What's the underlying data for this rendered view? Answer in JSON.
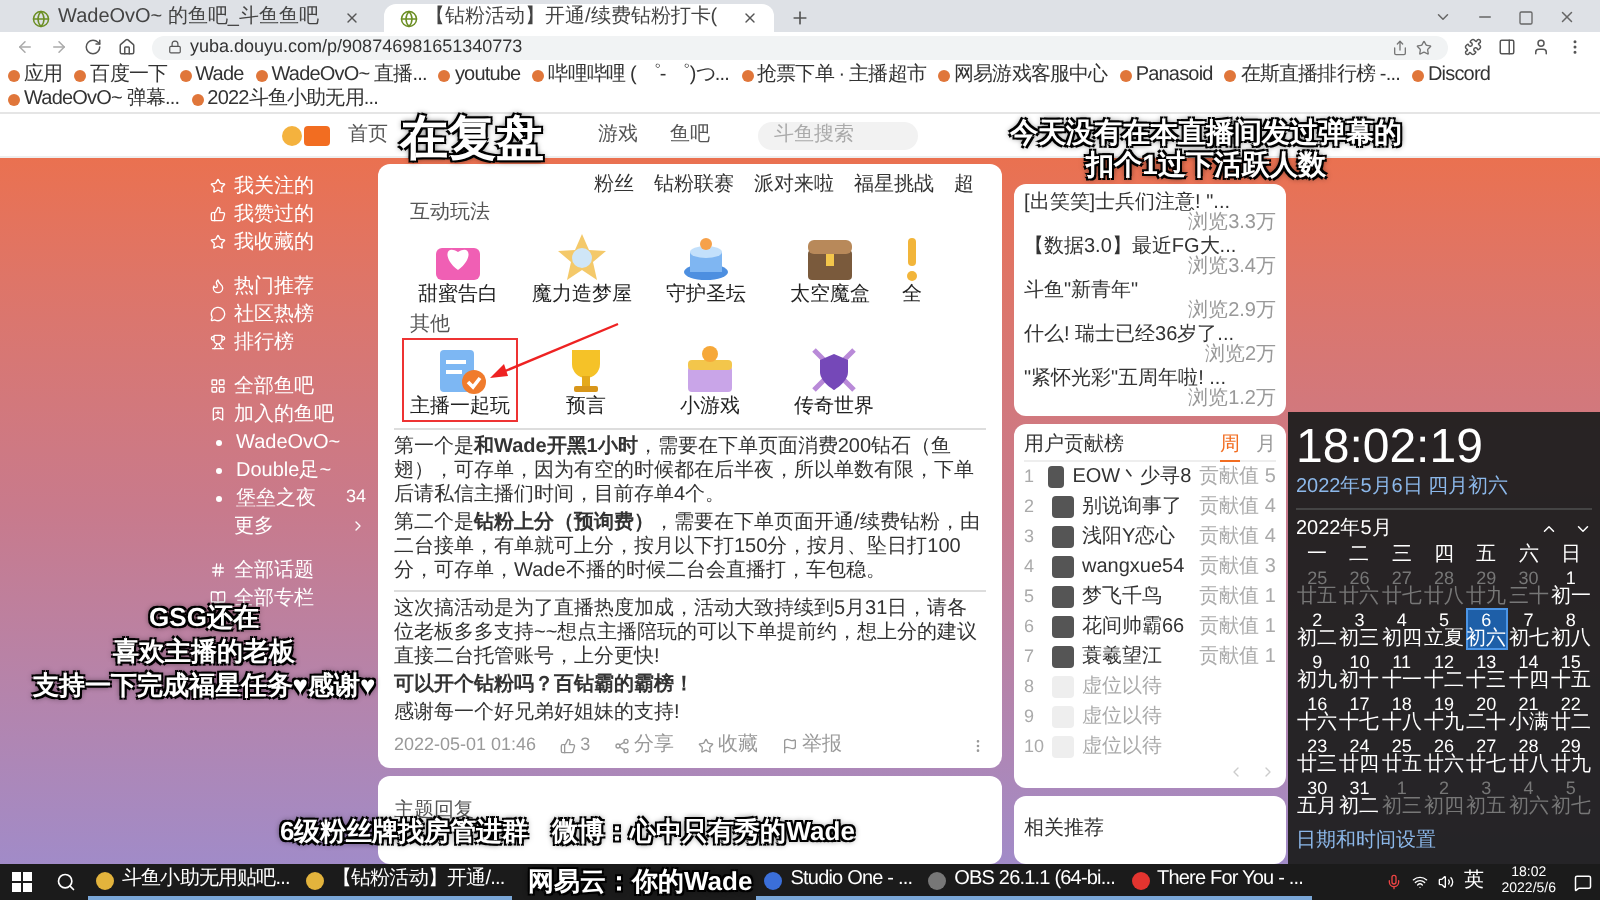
{
  "browser": {
    "tabs": [
      {
        "label": "WadeOvO~ 的鱼吧_斗鱼鱼吧",
        "selected": false
      },
      {
        "label": "【钻粉活动】开通/续费钻粉打卡(",
        "selected": true
      }
    ],
    "address": "yuba.douyu.com/p/908746981651340773",
    "bookmarks": [
      "应用",
      "百度一下",
      "Wade",
      "WadeOvO~ 直播...",
      "youtube",
      "哔哩哔哩 ( ゜- ゜)つ...",
      "抢票下单 · 主播超市",
      "网易游戏客服中心",
      "Panasoid",
      "在斯直播排行榜 -...",
      "Discord",
      "WadeOvO~ 弹幕...",
      "2022斗鱼小助无用..."
    ]
  },
  "site_header": {
    "nav": [
      "首页",
      "游戏",
      "鱼吧"
    ],
    "search": {
      "placeholder": "斗鱼搜索"
    }
  },
  "sidebar": {
    "groups": [
      {
        "items": [
          {
            "label": "我关注的",
            "kind": "link"
          },
          {
            "label": "我赞过的",
            "kind": "link"
          },
          {
            "label": "我收藏的",
            "kind": "link"
          }
        ]
      },
      {
        "items": [
          {
            "label": "热门推荐",
            "kind": "link"
          },
          {
            "label": "社区热榜",
            "kind": "link"
          },
          {
            "label": "排行榜",
            "kind": "link"
          }
        ]
      },
      {
        "items": [
          {
            "label": "全部鱼吧",
            "kind": "link"
          },
          {
            "label": "加入的鱼吧",
            "kind": "link"
          },
          {
            "label": "WadeOvO~",
            "kind": "bar"
          },
          {
            "label": "Double足~",
            "kind": "bar"
          },
          {
            "label": "堡垒之夜",
            "kind": "bar",
            "count": "34"
          },
          {
            "label": "更多",
            "kind": "more"
          }
        ]
      },
      {
        "items": [
          {
            "label": "全部话题",
            "kind": "link"
          },
          {
            "label": "全部专栏",
            "kind": "link"
          }
        ]
      }
    ]
  },
  "post": {
    "tabs": [
      "粉丝",
      "钻粉联赛",
      "派对来啦",
      "福星挑战",
      "超"
    ],
    "sections": [
      {
        "title": "互动玩法",
        "items": [
          {
            "label": "甜蜜告白",
            "highlighted": false
          },
          {
            "label": "魔力造梦屋",
            "highlighted": false
          },
          {
            "label": "守护圣坛",
            "highlighted": false
          },
          {
            "label": "太空魔盒",
            "highlighted": false
          },
          {
            "label": "全",
            "highlighted": false
          }
        ]
      },
      {
        "title": "其他",
        "items": [
          {
            "label": "主播一起玩",
            "highlighted": true
          },
          {
            "label": "预言",
            "highlighted": false
          },
          {
            "label": "小游戏",
            "highlighted": false
          },
          {
            "label": "传奇世界",
            "highlighted": false
          }
        ]
      }
    ],
    "blocks": [
      {
        "paragraphs": [
          {
            "kind": "body",
            "text": "第一个是**和Wade开黑1小时**，需要在下单页面消费200钻石（鱼翅），可存单，因为有空的时候都在后半夜，所以单数有限，下单后请私信主播们时间，目前存单4个。"
          },
          {
            "kind": "body",
            "text": "第二个是**钻粉上分（预询费）**，需要在下单页面开通/续费钻粉，由二台接单，有单就可上分，按月以下打150分，按月、坠日打100分，可存单，Wade不播的时候二台会直播打，车包稳。"
          }
        ]
      },
      {
        "paragraphs": [
          {
            "kind": "body",
            "text": "这次搞活动是为了直播热度加成，活动大致持续到5月31日，请各位老板多多支持~~想点主播陪玩的可以下单提前约，想上分的建议直接二台托管账号，上分更快!"
          },
          {
            "kind": "bold",
            "text": "可以开个钻粉吗？百钻霸的霸榜！"
          },
          {
            "kind": "body",
            "text": "感谢每一个好兄弟好姐妹的支持!"
          }
        ]
      }
    ],
    "meta": {
      "date": "2022-05-01 01:46",
      "likes": "3",
      "actions": [
        "分享",
        "收藏",
        "举报"
      ]
    }
  },
  "replies": {
    "title": "主题回复"
  },
  "hot_posts": [
    {
      "title": "[出笑笑]士兵们注意! \"...",
      "views": "浏览3.3万"
    },
    {
      "title": "【数据3.0】最近FG大...",
      "views": "浏览3.4万"
    },
    {
      "title": "斗鱼\"新青年\"",
      "views": "浏览2.9万"
    },
    {
      "title": "什么! 瑞士已经36岁了...",
      "views": "浏览2万"
    },
    {
      "title": "\"紧怀光彩\"五周年啦! ...",
      "views": "浏览1.2万"
    }
  ],
  "ranking": {
    "title": "用户贡献榜",
    "tabs": [
      {
        "label": "周",
        "selected": true
      },
      {
        "label": "月",
        "selected": false
      }
    ],
    "rows": [
      {
        "kind": "user",
        "rank": "1",
        "name": "EOW丶少寻8",
        "score": "贡献值 5"
      },
      {
        "kind": "user",
        "rank": "2",
        "name": "别说询事了",
        "score": "贡献值 4"
      },
      {
        "kind": "user",
        "rank": "3",
        "name": "浅阳Y恋心",
        "score": "贡献值 4"
      },
      {
        "kind": "user",
        "rank": "4",
        "name": "wangxue54",
        "score": "贡献值 3"
      },
      {
        "kind": "user",
        "rank": "5",
        "name": "梦飞千鸟",
        "score": "贡献值 1"
      },
      {
        "kind": "user",
        "rank": "6",
        "name": "花间帅霸66",
        "score": "贡献值 1"
      },
      {
        "kind": "user",
        "rank": "7",
        "name": "蓑羲望江",
        "score": "贡献值 1"
      },
      {
        "kind": "empty",
        "rank": "8",
        "name": "虚位以待"
      },
      {
        "kind": "empty",
        "rank": "9",
        "name": "虚位以待"
      },
      {
        "kind": "empty",
        "rank": "10",
        "name": "虚位以待"
      }
    ]
  },
  "related": {
    "title": "相关推荐"
  },
  "clock": {
    "time": "18:02:19",
    "date": "2022年5月6日 四月初六",
    "month": "2022年5月",
    "weekdays": [
      "一",
      "二",
      "三",
      "四",
      "五",
      "六",
      "日"
    ],
    "days": [
      {
        "day": "25",
        "lunar": "廿五",
        "in_month": false,
        "selected": false
      },
      {
        "day": "26",
        "lunar": "廿六",
        "in_month": false,
        "selected": false
      },
      {
        "day": "27",
        "lunar": "廿七",
        "in_month": false,
        "selected": false
      },
      {
        "day": "28",
        "lunar": "廿八",
        "in_month": false,
        "selected": false
      },
      {
        "day": "29",
        "lunar": "廿九",
        "in_month": false,
        "selected": false
      },
      {
        "day": "30",
        "lunar": "三十",
        "in_month": false,
        "selected": false
      },
      {
        "day": "1",
        "lunar": "初一",
        "in_month": true,
        "selected": false
      },
      {
        "day": "2",
        "lunar": "初二",
        "in_month": true,
        "selected": false
      },
      {
        "day": "3",
        "lunar": "初三",
        "in_month": true,
        "selected": false
      },
      {
        "day": "4",
        "lunar": "初四",
        "in_month": true,
        "selected": false
      },
      {
        "day": "5",
        "lunar": "立夏",
        "in_month": true,
        "selected": false
      },
      {
        "day": "6",
        "lunar": "初六",
        "in_month": true,
        "selected": true
      },
      {
        "day": "7",
        "lunar": "初七",
        "in_month": true,
        "selected": false
      },
      {
        "day": "8",
        "lunar": "初八",
        "in_month": true,
        "selected": false
      },
      {
        "day": "9",
        "lunar": "初九",
        "in_month": true,
        "selected": false
      },
      {
        "day": "10",
        "lunar": "初十",
        "in_month": true,
        "selected": false
      },
      {
        "day": "11",
        "lunar": "十一",
        "in_month": true,
        "selected": false
      },
      {
        "day": "12",
        "lunar": "十二",
        "in_month": true,
        "selected": false
      },
      {
        "day": "13",
        "lunar": "十三",
        "in_month": true,
        "selected": false
      },
      {
        "day": "14",
        "lunar": "十四",
        "in_month": true,
        "selected": false
      },
      {
        "day": "15",
        "lunar": "十五",
        "in_month": true,
        "selected": false
      },
      {
        "day": "16",
        "lunar": "十六",
        "in_month": true,
        "selected": false
      },
      {
        "day": "17",
        "lunar": "十七",
        "in_month": true,
        "selected": false
      },
      {
        "day": "18",
        "lunar": "十八",
        "in_month": true,
        "selected": false
      },
      {
        "day": "19",
        "lunar": "十九",
        "in_month": true,
        "selected": false
      },
      {
        "day": "20",
        "lunar": "二十",
        "in_month": true,
        "selected": false
      },
      {
        "day": "21",
        "lunar": "小满",
        "in_month": true,
        "selected": false
      },
      {
        "day": "22",
        "lunar": "廿二",
        "in_month": true,
        "selected": false
      },
      {
        "day": "23",
        "lunar": "廿三",
        "in_month": true,
        "selected": false
      },
      {
        "day": "24",
        "lunar": "廿四",
        "in_month": true,
        "selected": false
      },
      {
        "day": "25",
        "lunar": "廿五",
        "in_month": true,
        "selected": false
      },
      {
        "day": "26",
        "lunar": "廿六",
        "in_month": true,
        "selected": false
      },
      {
        "day": "27",
        "lunar": "廿七",
        "in_month": true,
        "selected": false
      },
      {
        "day": "28",
        "lunar": "廿八",
        "in_month": true,
        "selected": false
      },
      {
        "day": "29",
        "lunar": "廿九",
        "in_month": true,
        "selected": false
      },
      {
        "day": "30",
        "lunar": "五月",
        "in_month": true,
        "selected": false
      },
      {
        "day": "31",
        "lunar": "初二",
        "in_month": true,
        "selected": false
      },
      {
        "day": "1",
        "lunar": "初三",
        "in_month": false,
        "selected": false
      },
      {
        "day": "2",
        "lunar": "初四",
        "in_month": false,
        "selected": false
      },
      {
        "day": "3",
        "lunar": "初五",
        "in_month": false,
        "selected": false
      },
      {
        "day": "4",
        "lunar": "初六",
        "in_month": false,
        "selected": false
      },
      {
        "day": "5",
        "lunar": "初七",
        "in_month": false,
        "selected": false
      }
    ],
    "settings_link": "日期和时间设置"
  },
  "taskbar": {
    "tasks": [
      {
        "label": "斗鱼小助无用贴吧..."
      },
      {
        "label": "【钻粉活动】开通/..."
      },
      {
        "label": "Studio One - ..."
      },
      {
        "label": "OBS 26.1.1 (64-bi..."
      },
      {
        "label": "There For You - ..."
      }
    ],
    "ime": "英",
    "time": "18:02",
    "date": "2022/5/6"
  },
  "captions": {
    "title": "在复盘",
    "top_right": [
      "今天没有在本直播间发过弹幕的",
      "扣个1过下活跃人数"
    ],
    "left": [
      "GSG还在",
      "喜欢主播的老板",
      "支持一下完成福星任务♥感谢♥"
    ],
    "bottom": [
      "6级粉丝牌找房管进群",
      "微博：心中只有秀的Wade"
    ],
    "bottom_second": [
      "网易云：你的Wade"
    ]
  }
}
